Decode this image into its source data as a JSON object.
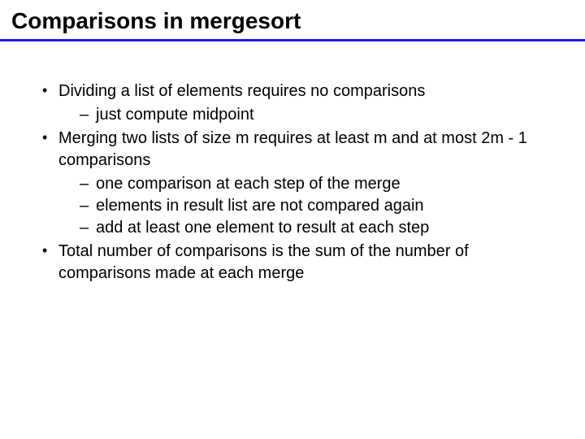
{
  "slide": {
    "title": "Comparisons in mergesort",
    "bullets": [
      {
        "text": "Dividing a list of elements requires no comparisons",
        "sub": [
          "just compute midpoint"
        ]
      },
      {
        "text": "Merging two lists of size m requires at least m and at most 2m - 1 comparisons",
        "sub": [
          "one comparison at each step of the merge",
          "elements in result list are not compared again",
          "add at least one element to result at each step"
        ]
      },
      {
        "text": "Total number of comparisons is the sum of the number of comparisons made at each merge",
        "sub": []
      }
    ]
  }
}
